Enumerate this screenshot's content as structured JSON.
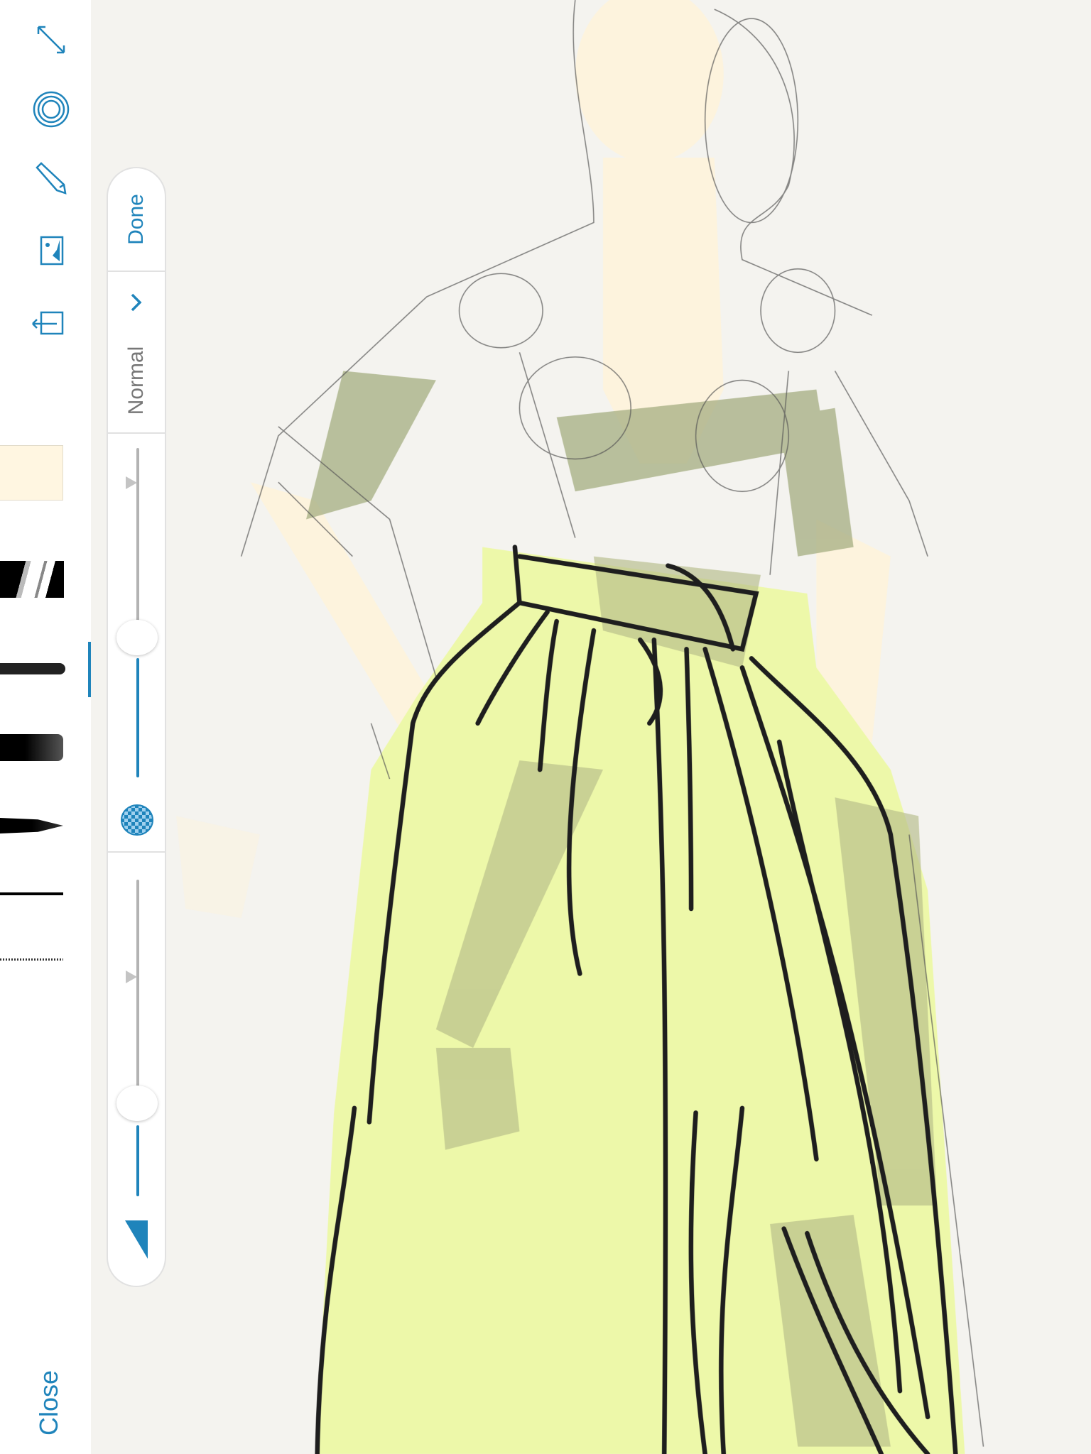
{
  "sidebar": {
    "icons": [
      "expand-icon",
      "layers-icon",
      "pencil-icon",
      "image-icon",
      "export-icon"
    ],
    "close_label": "Close",
    "current_color": "#fff6e1",
    "brushes": [
      "stripes-brush",
      "textured-brush",
      "gradient-brush",
      "taper-brush",
      "thin-line-brush",
      "dotted-brush"
    ],
    "active_brush_index": 1
  },
  "panel": {
    "done_label": "Done",
    "blend_mode": "Normal",
    "opacity_value": 0.35,
    "size_value": 0.3
  },
  "colors": {
    "accent": "#1f84bb",
    "canvas": "#f4f3ef"
  }
}
